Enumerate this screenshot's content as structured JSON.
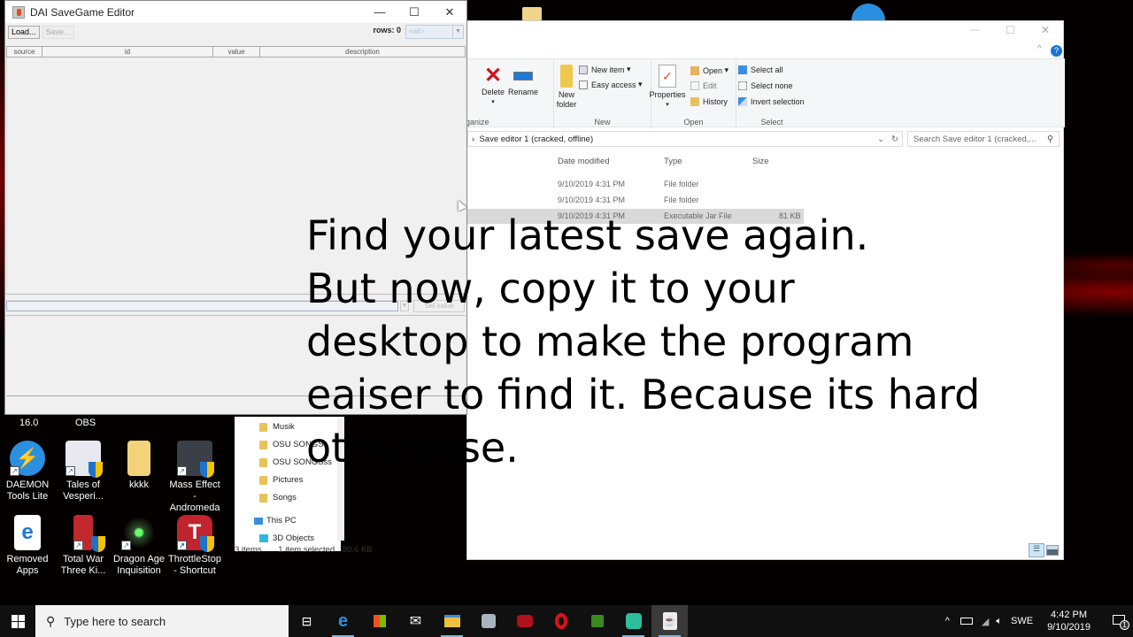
{
  "desktop": {
    "top_labels": [
      "16.0",
      "OBS"
    ],
    "icons": [
      {
        "label": "DAEMON Tools Lite",
        "icon": "daemon-tools-icon",
        "color": "#2b8fe0"
      },
      {
        "label": "Tales of Vesperi...",
        "icon": "tales-of-vesperia-icon",
        "color": "#e8e8f0"
      },
      {
        "label": "kkkk",
        "icon": "folder-icon",
        "color": "#f3d27a"
      },
      {
        "label": "Mass Effect - Andromeda",
        "icon": "mass-effect-icon",
        "color": "#3a3f48"
      },
      {
        "label": "Removed Apps",
        "icon": "edge-document-icon",
        "color": "#ffffff"
      },
      {
        "label": "Total War Three Ki...",
        "icon": "total-war-icon",
        "color": "#c0282c"
      },
      {
        "label": "Dragon Age Inquisition",
        "icon": "dragon-age-icon",
        "color": "#2e4b2e"
      },
      {
        "label": "ThrottleStop - Shortcut",
        "icon": "throttlestop-icon",
        "color": "#c0242e"
      }
    ]
  },
  "java_window": {
    "title": "DAI SaveGame Editor",
    "load_label": "Load...",
    "save_label": "Save...",
    "rows_label": "rows: 0",
    "filter_value": "<all>",
    "columns": [
      "source",
      "id",
      "value",
      "description"
    ],
    "value_input": "",
    "set_value_label": "Set value",
    "controls": {
      "minimize": "—",
      "maximize": "☐",
      "close": "✕"
    }
  },
  "explorer": {
    "controls": {
      "minimize": "—",
      "maximize": "☐",
      "close": "✕"
    },
    "ribbon": {
      "organize": {
        "label": "Organize",
        "delete": "Delete",
        "rename": "Rename"
      },
      "new": {
        "label": "New",
        "new_folder": "New folder",
        "new_item": "New item",
        "easy_access": "Easy access"
      },
      "open": {
        "label": "Open",
        "properties": "Properties",
        "open": "Open",
        "edit": "Edit",
        "history": "History"
      },
      "select": {
        "label": "Select",
        "select_all": "Select all",
        "select_none": "Select none",
        "invert_selection": "Invert selection"
      }
    },
    "address": "Save editor 1 (cracked, offline)",
    "search_placeholder": "Search Save editor 1 (cracked,...",
    "columns": [
      "Date modified",
      "Type",
      "Size"
    ],
    "files": [
      {
        "date": "9/10/2019 4:31 PM",
        "type": "File folder",
        "size": ""
      },
      {
        "date": "9/10/2019 4:31 PM",
        "type": "File folder",
        "size": ""
      },
      {
        "date": "9/10/2019 4:31 PM",
        "type": "Executable Jar File",
        "size": "81 KB",
        "selected": true
      }
    ],
    "nav": [
      "Musik",
      "OSU SONGS",
      "OSU SONGSss",
      "Pictures",
      "Songs",
      "This PC",
      "3D Objects"
    ],
    "status": {
      "items": "3 items",
      "selected": "1 item selected",
      "size": "80.6 KB"
    }
  },
  "overlay_text": "Find your latest save again.\nBut now, copy it to your\ndesktop to make the program\neaiser to find it. Because its hard\notherwise.",
  "taskbar": {
    "search_placeholder": "Type here to search",
    "apps": [
      "task-view-icon",
      "edge-icon",
      "store-icon",
      "mail-icon",
      "file-explorer-icon",
      "app-icon",
      "msi-dragon-icon",
      "opera-icon",
      "nvidia-icon",
      "chat-icon",
      "java-icon"
    ],
    "language": "SWE",
    "time": "4:42 PM",
    "date": "9/10/2019",
    "notification_count": "1"
  }
}
